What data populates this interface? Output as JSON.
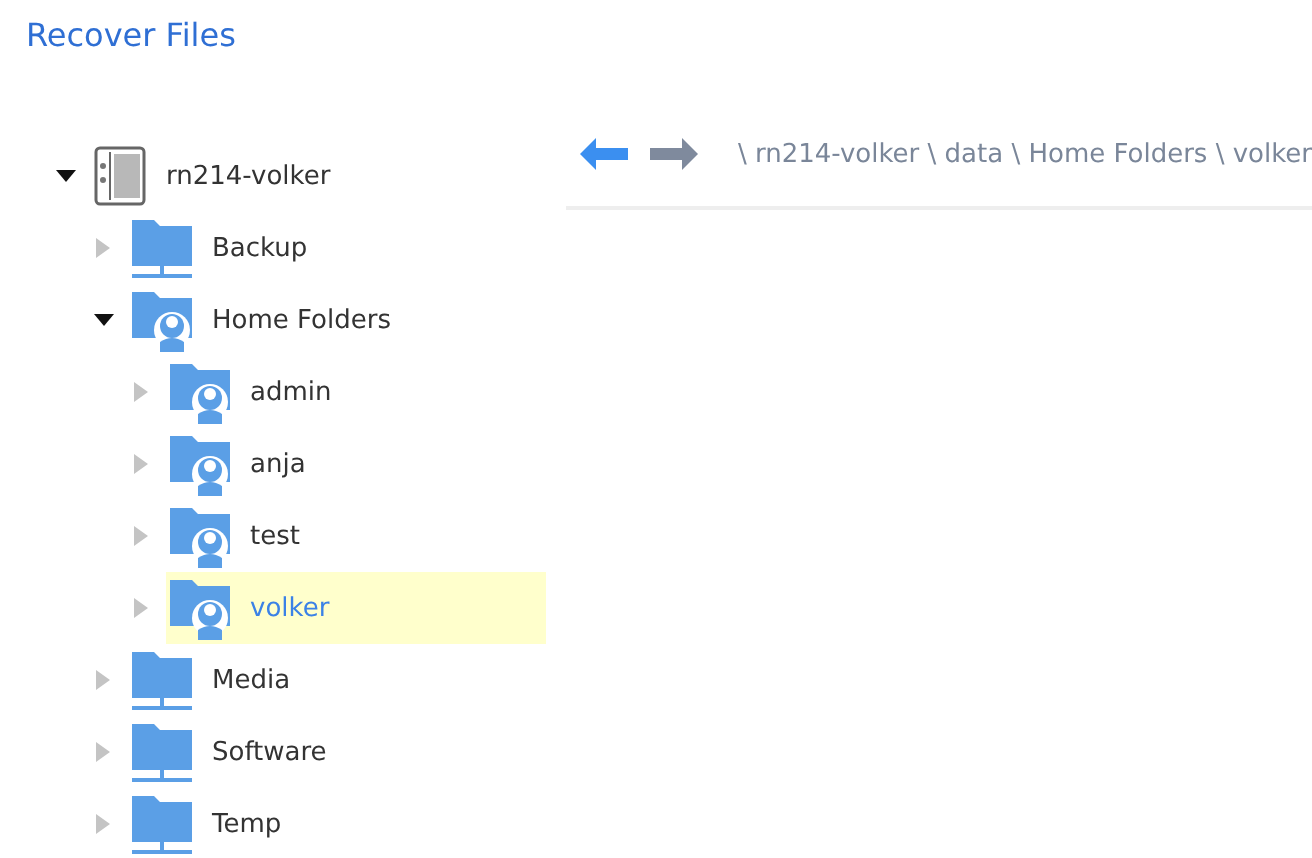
{
  "title": "Recover Files",
  "tree": [
    {
      "label": "rn214-volker",
      "kind": "device",
      "expanded": true,
      "selected": false,
      "children": [
        {
          "label": "Backup",
          "kind": "share",
          "expanded": false,
          "selected": false
        },
        {
          "label": "Home Folders",
          "kind": "home",
          "expanded": true,
          "selected": false,
          "children": [
            {
              "label": "admin",
              "kind": "home",
              "expanded": false,
              "selected": false
            },
            {
              "label": "anja",
              "kind": "home",
              "expanded": false,
              "selected": false
            },
            {
              "label": "test",
              "kind": "home",
              "expanded": false,
              "selected": false
            },
            {
              "label": "volker",
              "kind": "home",
              "expanded": false,
              "selected": true
            }
          ]
        },
        {
          "label": "Media",
          "kind": "share",
          "expanded": false,
          "selected": false
        },
        {
          "label": "Software",
          "kind": "share",
          "expanded": false,
          "selected": false
        },
        {
          "label": "Temp",
          "kind": "share",
          "expanded": false,
          "selected": false
        }
      ]
    }
  ],
  "path": "\\ rn214-volker \\ data \\ Home Folders \\ volker"
}
